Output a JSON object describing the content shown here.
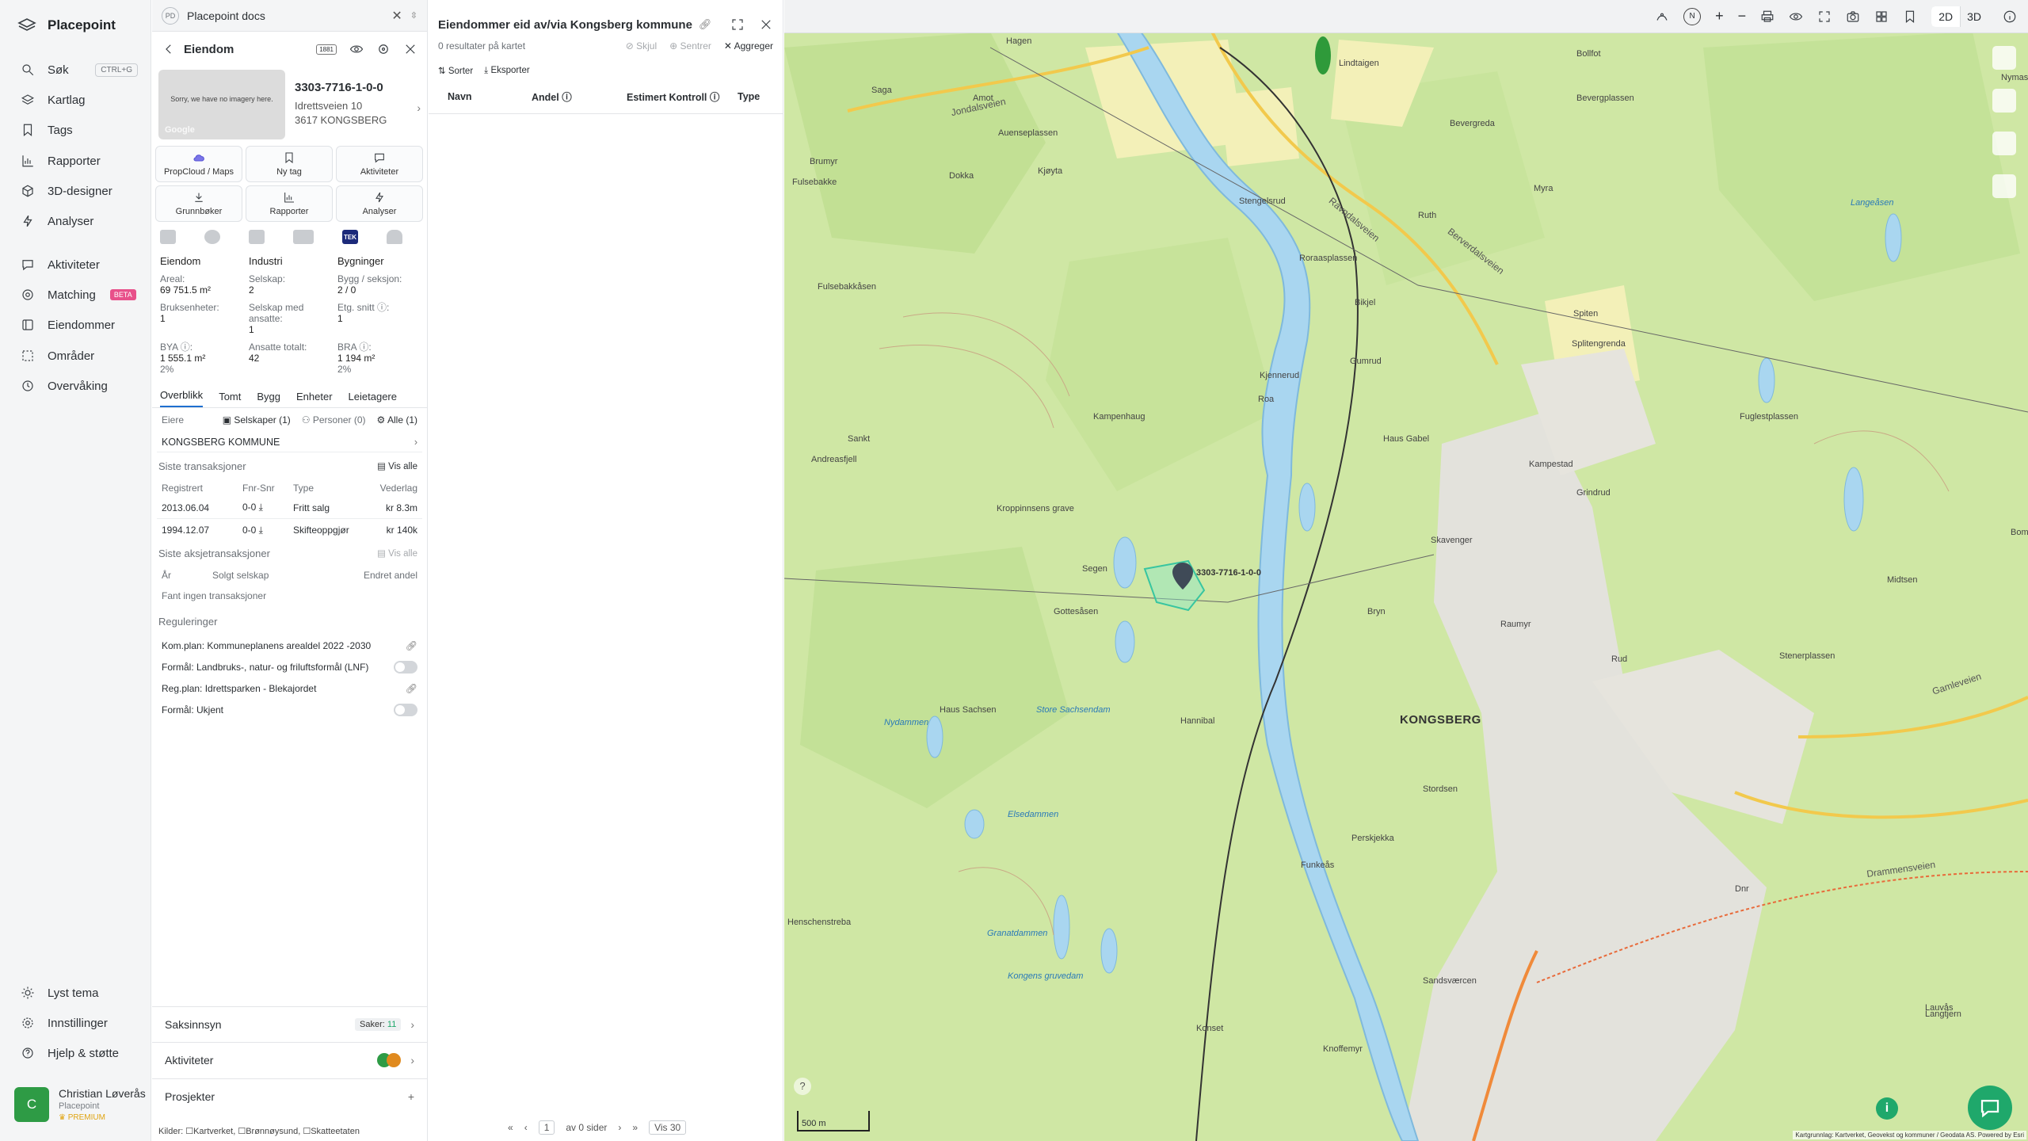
{
  "nav": {
    "brand": "Placepoint",
    "items": [
      {
        "label": "Søk",
        "kbd": "CTRL+G"
      },
      {
        "label": "Kartlag"
      },
      {
        "label": "Tags"
      },
      {
        "label": "Rapporter"
      },
      {
        "label": "3D-designer"
      },
      {
        "label": "Analyser"
      },
      {
        "label": "Aktiviteter"
      },
      {
        "label": "Matching",
        "badge": "BETA"
      },
      {
        "label": "Eiendommer"
      },
      {
        "label": "Områder"
      },
      {
        "label": "Overvåking"
      },
      {
        "label": "Lyst tema"
      },
      {
        "label": "Innstillinger"
      },
      {
        "label": "Hjelp & støtte"
      }
    ],
    "user": {
      "initial": "C",
      "name": "Christian Løverås",
      "org": "Placepoint",
      "plan": "PREMIUM"
    }
  },
  "doc": {
    "badge": "PD",
    "title": "Placepoint docs"
  },
  "property": {
    "header": "Eiendom",
    "thumb_text": "Sorry, we have no imagery here.",
    "thumb_brand": "Google",
    "id": "3303-7716-1-0-0",
    "address1": "Idrettsveien 10",
    "address2": "3617 KONGSBERG",
    "tiles": [
      "PropCloud / Maps",
      "Ny tag",
      "Aktiviteter",
      "Grunnbøker",
      "Rapporter",
      "Analyser"
    ],
    "tek": "TEK",
    "facts": {
      "col1_head": "Eiendom",
      "col2_head": "Industri",
      "col3_head": "Bygninger",
      "areal_k": "Areal:",
      "areal_v": "69 751.5 m²",
      "selskap_k": "Selskap:",
      "selskap_v": "2",
      "bygg_k": "Bygg / seksjon:",
      "bygg_v": "2 / 0",
      "bruks_k": "Bruksenheter:",
      "bruks_v": "1",
      "ansatte_k": "Selskap med ansatte:",
      "ansatte_v": "1",
      "etg_k": "Etg. snitt ⓘ:",
      "etg_v": "1",
      "bya_k": "BYA ⓘ:",
      "bya_v": "1 555.1 m²",
      "bya_p": "2%",
      "ans_tot_k": "Ansatte totalt:",
      "ans_tot_v": "42",
      "bra_k": "BRA ⓘ:",
      "bra_v": "1 194 m²",
      "bra_p": "2%"
    },
    "tabs": [
      "Overblikk",
      "Tomt",
      "Bygg",
      "Enheter",
      "Leietagere"
    ],
    "owners": {
      "label": "Eiere",
      "companies": "Selskaper (1)",
      "persons": "Personer (0)",
      "all": "Alle (1)",
      "name": "KONGSBERG KOMMUNE"
    },
    "transactions": {
      "title": "Siste transaksjoner",
      "show_all": "Vis alle",
      "cols": [
        "Registrert",
        "Fnr-Snr",
        "Type",
        "Vederlag"
      ],
      "rows": [
        {
          "date": "2013.06.04",
          "fnr": "0-0 ⤓",
          "type": "Fritt salg",
          "price": "kr 8.3m"
        },
        {
          "date": "1994.12.07",
          "fnr": "0-0 ⤓",
          "type": "Skifteoppgjør",
          "price": "kr 140k"
        }
      ]
    },
    "share_tx": {
      "title": "Siste aksjetransaksjoner",
      "show_all": "Vis alle",
      "cols": [
        "År",
        "Solgt selskap",
        "Endret andel"
      ],
      "empty": "Fant ingen transaksjoner"
    },
    "regulations": {
      "title": "Reguleringer",
      "items": [
        "Kom.plan: Kommuneplanens arealdel 2022 -2030",
        "Formål: Landbruks-, natur- og friluftsformål (LNF)",
        "Reg.plan: Idrettsparken - Blekajordet",
        "Formål: Ukjent"
      ]
    },
    "saksinnsyn": "Saksinnsyn",
    "saker_label": "Saker:",
    "saker_count": "11",
    "aktiviteter": "Aktiviteter",
    "prosjekter": "Prosjekter",
    "sources": "Kilder: ☐Kartverket, ☐Brønnøysund, ☐Skatteetaten"
  },
  "owned": {
    "title": "Eiendommer eid av/via Kongsberg kommune",
    "count": "0 resultater på kartet",
    "actions": [
      "Skjul",
      "Sentrer",
      "Aggreger"
    ],
    "sort": "Sorter",
    "export": "Eksporter",
    "cols": [
      "Navn",
      "Andel ⓘ",
      "Estimert Kontroll ⓘ",
      "Type"
    ],
    "pager": {
      "page": "1",
      "of": "av 0 sider",
      "per": "Vis 30"
    }
  },
  "map": {
    "town": "KONGSBERG",
    "marker_label": "3303-7716-1-0-0",
    "places": [
      "Hagen",
      "Saga",
      "Amot",
      "Lindtaigen",
      "Bollfot",
      "Jondalsveien",
      "Auenseplassen",
      "Bevergplassen",
      "Bevergreda",
      "Brumyr",
      "Dokka",
      "Kjøyta",
      "Fulsebakke",
      "Stengelsrud",
      "Myra",
      "Ruth",
      "Ravndalsveien",
      "Berverdalsveien",
      "Roraasplassen",
      "Bikjel",
      "Fulsebakkåsen",
      "Spiten",
      "Splitengrenda",
      "Gumrud",
      "Kjennerud",
      "Roa",
      "Kampenhaug",
      "Sankt",
      "Andreasfjell",
      "Haus Gabel",
      "Kroppinnsens grave",
      "Skavenger",
      "Segen",
      "Gottesåsen",
      "Bryn",
      "Haus Sachsen",
      "Hannibal",
      "Store Sachsendam",
      "Nydammen",
      "Elsedammen",
      "Funkeås",
      "Henschenstreba",
      "Granatdammen",
      "Kongens gruvedam",
      "Konset",
      "Sandsværcen",
      "Knoffemyr",
      "Langeåsen",
      "Lauvås",
      "Langtjern",
      "Fuglestplassen",
      "Kampestad",
      "Grindrud",
      "Rud",
      "Stenerplassen",
      "Drammensveien",
      "Gamleveien",
      "Nymaskreda",
      "Raumyr",
      "Midtsen",
      "Perskjekka",
      "Stordsen",
      "Dnr",
      "Bomi"
    ],
    "roads": [
      "Drammensveien",
      "Gamleveien",
      "Jondalsveien"
    ],
    "scale": "500 m",
    "attribution": "Kartgrunnlag: Kartverket, Geovekst og kommuner / Geodata AS. Powered by Esri",
    "view_2d": "2D",
    "view_3d": "3D",
    "north": "N"
  }
}
